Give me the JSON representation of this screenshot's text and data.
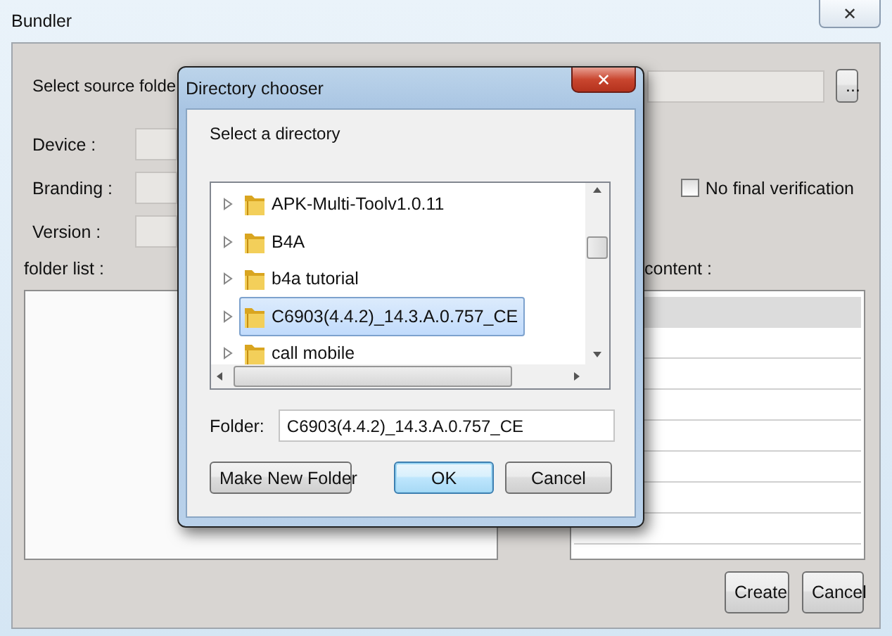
{
  "window": {
    "title": "Bundler",
    "close": "✕"
  },
  "form": {
    "source_label": "Select source folde",
    "browse_button": "...",
    "device_label": "Device :",
    "branding_label": "Branding :",
    "version_label": "Version :",
    "no_final_verification": {
      "label": "No final verification",
      "checked": false
    },
    "folder_list_label": "folder list :",
    "content_label": "content :"
  },
  "buttons": [
    "Create",
    "Cancel"
  ],
  "dialog": {
    "title": "Directory chooser",
    "close": "✕",
    "prompt": "Select a directory",
    "tree": [
      {
        "label": "APK-Multi-Toolv1.0.11",
        "expanded": false,
        "selected": false
      },
      {
        "label": "B4A",
        "expanded": false,
        "selected": false
      },
      {
        "label": "b4a tutorial",
        "expanded": false,
        "selected": false
      },
      {
        "label": "C6903(4.4.2)_14.3.A.0.757_CE",
        "expanded": false,
        "selected": true
      },
      {
        "label": "call mobile",
        "expanded": false,
        "selected": false
      }
    ],
    "folder_label": "Folder:",
    "folder_value": "C6903(4.4.2)_14.3.A.0.757_CE",
    "buttons": [
      {
        "label": "Make New Folder",
        "default": false
      },
      {
        "label": "OK",
        "default": true
      },
      {
        "label": "Cancel",
        "default": false
      }
    ]
  }
}
